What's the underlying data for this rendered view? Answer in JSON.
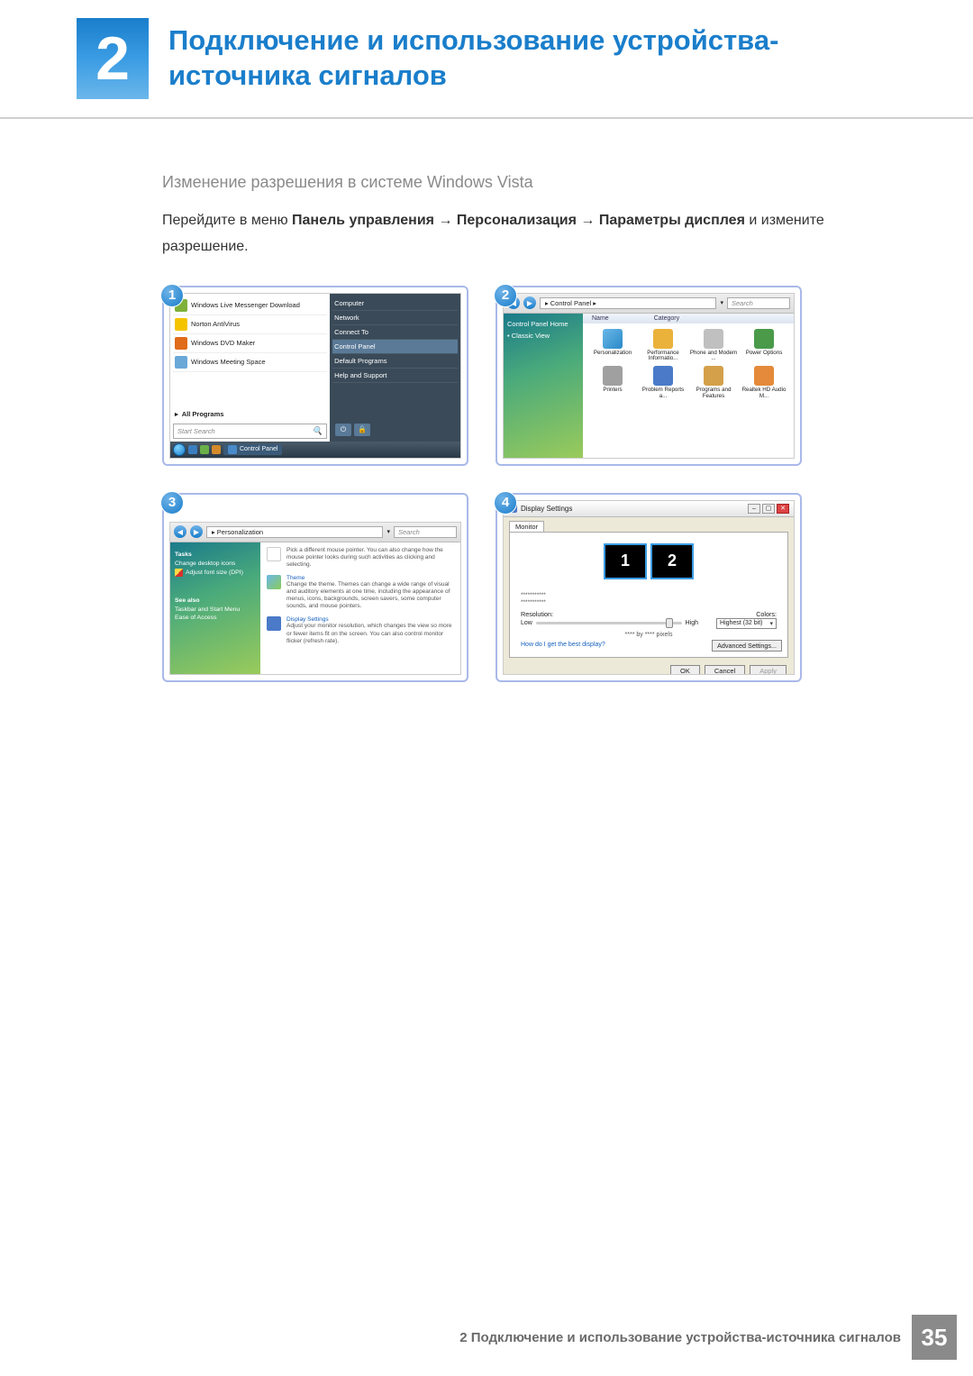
{
  "header": {
    "chapter_number": "2",
    "title": "Подключение и использование устройства-источника сигналов"
  },
  "content": {
    "subheading": "Изменение разрешения в системе Windows Vista",
    "instruction_prefix": "Перейдите в меню ",
    "path_1": "Панель управления",
    "arrow": " → ",
    "path_2": "Персонализация",
    "path_3": "Параметры дисплея",
    "instruction_suffix": " и измените разрешение."
  },
  "steps": {
    "s1": "1",
    "s2": "2",
    "s3": "3",
    "s4": "4"
  },
  "screenshot1": {
    "left_items": [
      "Windows Live Messenger Download",
      "Norton AntiVirus",
      "Windows DVD Maker",
      "Windows Meeting Space"
    ],
    "all_programs": "All Programs",
    "search": "Start Search",
    "right_items": [
      "Computer",
      "Network",
      "Connect To",
      "Control Panel",
      "Default Programs",
      "Help and Support"
    ],
    "taskbar_label": "Control Panel"
  },
  "screenshot2": {
    "crumb": "Control Panel",
    "search": "Search",
    "side": [
      "Control Panel Home",
      "Classic View"
    ],
    "columns": [
      "Name",
      "Category"
    ],
    "icons": [
      "Personalization",
      "Performance Informatio...",
      "Phone and Modem ...",
      "Power Options",
      "Printers",
      "Problem Reports a...",
      "Programs and Features",
      "Realtek HD Audio M..."
    ]
  },
  "screenshot3": {
    "crumb": "Personalization",
    "search": "Search",
    "side_tasks": "Tasks",
    "side_links_top": [
      "Change desktop icons",
      "Adjust font size (DPI)"
    ],
    "side_seealso": "See also",
    "side_links_bottom": [
      "Taskbar and Start Menu",
      "Ease of Access"
    ],
    "rows": [
      {
        "title": "",
        "text": "Pick a different mouse pointer. You can also change how the mouse pointer looks during such activities as clicking and selecting."
      },
      {
        "title": "Theme",
        "text": "Change the theme. Themes can change a wide range of visual and auditory elements at one time, including the appearance of menus, icons, backgrounds, screen savers, some computer sounds, and mouse pointers."
      },
      {
        "title": "Display Settings",
        "text": "Adjust your monitor resolution, which changes the view so more or fewer items fit on the screen. You can also control monitor flicker (refresh rate)."
      }
    ]
  },
  "screenshot4": {
    "title": "Display Settings",
    "tab": "Monitor",
    "mon1": "1",
    "mon2": "2",
    "stars": "***********",
    "resolution_label": "Resolution:",
    "colors_label": "Colors:",
    "low": "Low",
    "high": "High",
    "res_value": "**** by **** pixels",
    "color_value": "Highest (32 bit)",
    "help_link": "How do I get the best display?",
    "advanced": "Advanced Settings...",
    "ok": "OK",
    "cancel": "Cancel",
    "apply": "Apply"
  },
  "footer": {
    "text": "2 Подключение и использование устройства-источника сигналов",
    "page": "35"
  }
}
